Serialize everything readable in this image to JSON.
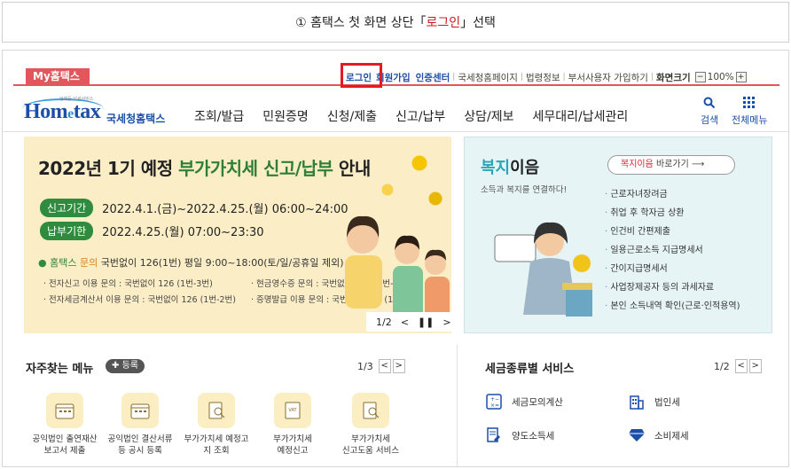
{
  "caption": {
    "prefix": "① 홈택스 첫 화면 상단「",
    "highlight": "로그인",
    "suffix": "」선택"
  },
  "top": {
    "my_tab": "My홈택스",
    "login": "로그인",
    "signup": "회원가입",
    "cert": "인증센터",
    "links": [
      "국세청홈페이지",
      "법령정보",
      "부서사용자 가입하기"
    ],
    "screen_size": "화면크기",
    "zoom": "100%"
  },
  "nav": {
    "logo_tagline": "언제든 납세서비스",
    "logo_text": "Hometax",
    "logo_sub": "국세청홈택스",
    "menu": [
      "조회/발급",
      "민원증명",
      "신청/제출",
      "신고/납부",
      "상담/제보",
      "세무대리/납세관리"
    ],
    "search": "검색",
    "all_menu": "전체메뉴"
  },
  "banner": {
    "title_pre": "2022년 1기 예정 ",
    "title_hl": "부가가치세 신고/납부",
    "title_post": " 안내",
    "period_label": "신고기간",
    "period": "2022.4.1.(금)~2022.4.25.(월) 06:00~24:00",
    "due_label": "납부기한",
    "due": "2022.4.25.(월) 07:00~23:30",
    "info_prefix": "홈택스",
    "info_mid": " 문의 ",
    "info_main": "국번없이 126(1번) 평일 9:00~18:00(토/일/공휴일 제외)",
    "details": [
      "· 전자신고 이용 문의 : 국번없이 126 (1번-3번)",
      "· 현금영수증 문의 : 국번없이 126 (1번-1번)",
      "· 전자세금계산서 이용 문의 : 국번없이 126 (1번-2번)",
      "· 증명발급 이용 문의 : 국번없이 126 (1번-7번)"
    ],
    "page": "1/2"
  },
  "welfare": {
    "title_a": "복지",
    "title_b": "이음",
    "sub": "소득과 복지를 연결하다!",
    "btn_hl": "복지이음",
    "btn_text": " 바로가기",
    "items": [
      "근로자녀장려금",
      "취업 후 학자금 상환",
      "인건비 간편제출",
      "일용근로소득 지급명세서",
      "간이지급명세서",
      "사업장제공자 등의 과세자료",
      "본인 소득내역 확인(근로·인적용역)"
    ]
  },
  "favorites": {
    "title": "자주찾는 메뉴",
    "reg": "등록",
    "page": "1/3",
    "items": [
      {
        "l1": "공익법인 출연재산",
        "l2": "보고서 제출",
        "icon": "calendar-icon"
      },
      {
        "l1": "공익법인 결산서류",
        "l2": "등 공시 등록",
        "icon": "calendar-icon"
      },
      {
        "l1": "부가가치세 예정고",
        "l2": "지 조회",
        "icon": "document-search-icon"
      },
      {
        "l1": "부가가치세",
        "l2": "예정신고",
        "icon": "vat-doc-icon"
      },
      {
        "l1": "부가가치세",
        "l2": "신고도움 서비스",
        "icon": "document-search-icon"
      }
    ]
  },
  "tax_services": {
    "title": "세금종류별 서비스",
    "page": "1/2",
    "items": [
      "세금모의계산",
      "법인세",
      "양도소득세",
      "소비제세"
    ]
  },
  "colors": {
    "brand_blue": "#1a4ea8",
    "highlight_red": "#e31b23",
    "banner_green": "#2f8c3e"
  }
}
